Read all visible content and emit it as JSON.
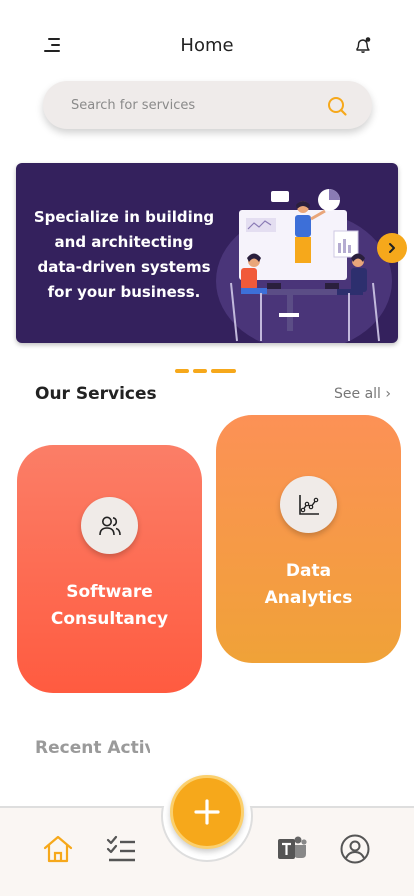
{
  "header": {
    "title": "Home",
    "menu_icon": "menu-icon",
    "notification_icon": "bell-icon"
  },
  "search": {
    "placeholder": "Search for services",
    "icon": "search-icon"
  },
  "banner": {
    "lines": [
      "Specialize in building",
      "and architecting",
      "data-driven systems",
      "for your business."
    ],
    "next_icon": "chevron-right-icon",
    "background_color": "#34215d",
    "active_slide": 3,
    "slide_count": 3
  },
  "services": {
    "title": "Our Services",
    "see_all": "See all ›",
    "items": [
      {
        "lines": [
          "Software",
          "Consultancy"
        ],
        "icon": "users-icon"
      },
      {
        "lines": [
          "Data",
          "Analytics"
        ],
        "icon": "chart-icon"
      }
    ]
  },
  "recent": {
    "title": "Recent Activity"
  },
  "bottom_nav": {
    "items": [
      {
        "icon": "home-icon",
        "active": true
      },
      {
        "icon": "tasks-icon",
        "active": false
      },
      {
        "icon": "teams-icon",
        "active": false
      },
      {
        "icon": "profile-icon",
        "active": false
      }
    ],
    "fab_icon": "plus-icon"
  },
  "colors": {
    "accent": "#f6a81b",
    "software_card": "#ff6a50",
    "data_card": "#f59b47"
  }
}
